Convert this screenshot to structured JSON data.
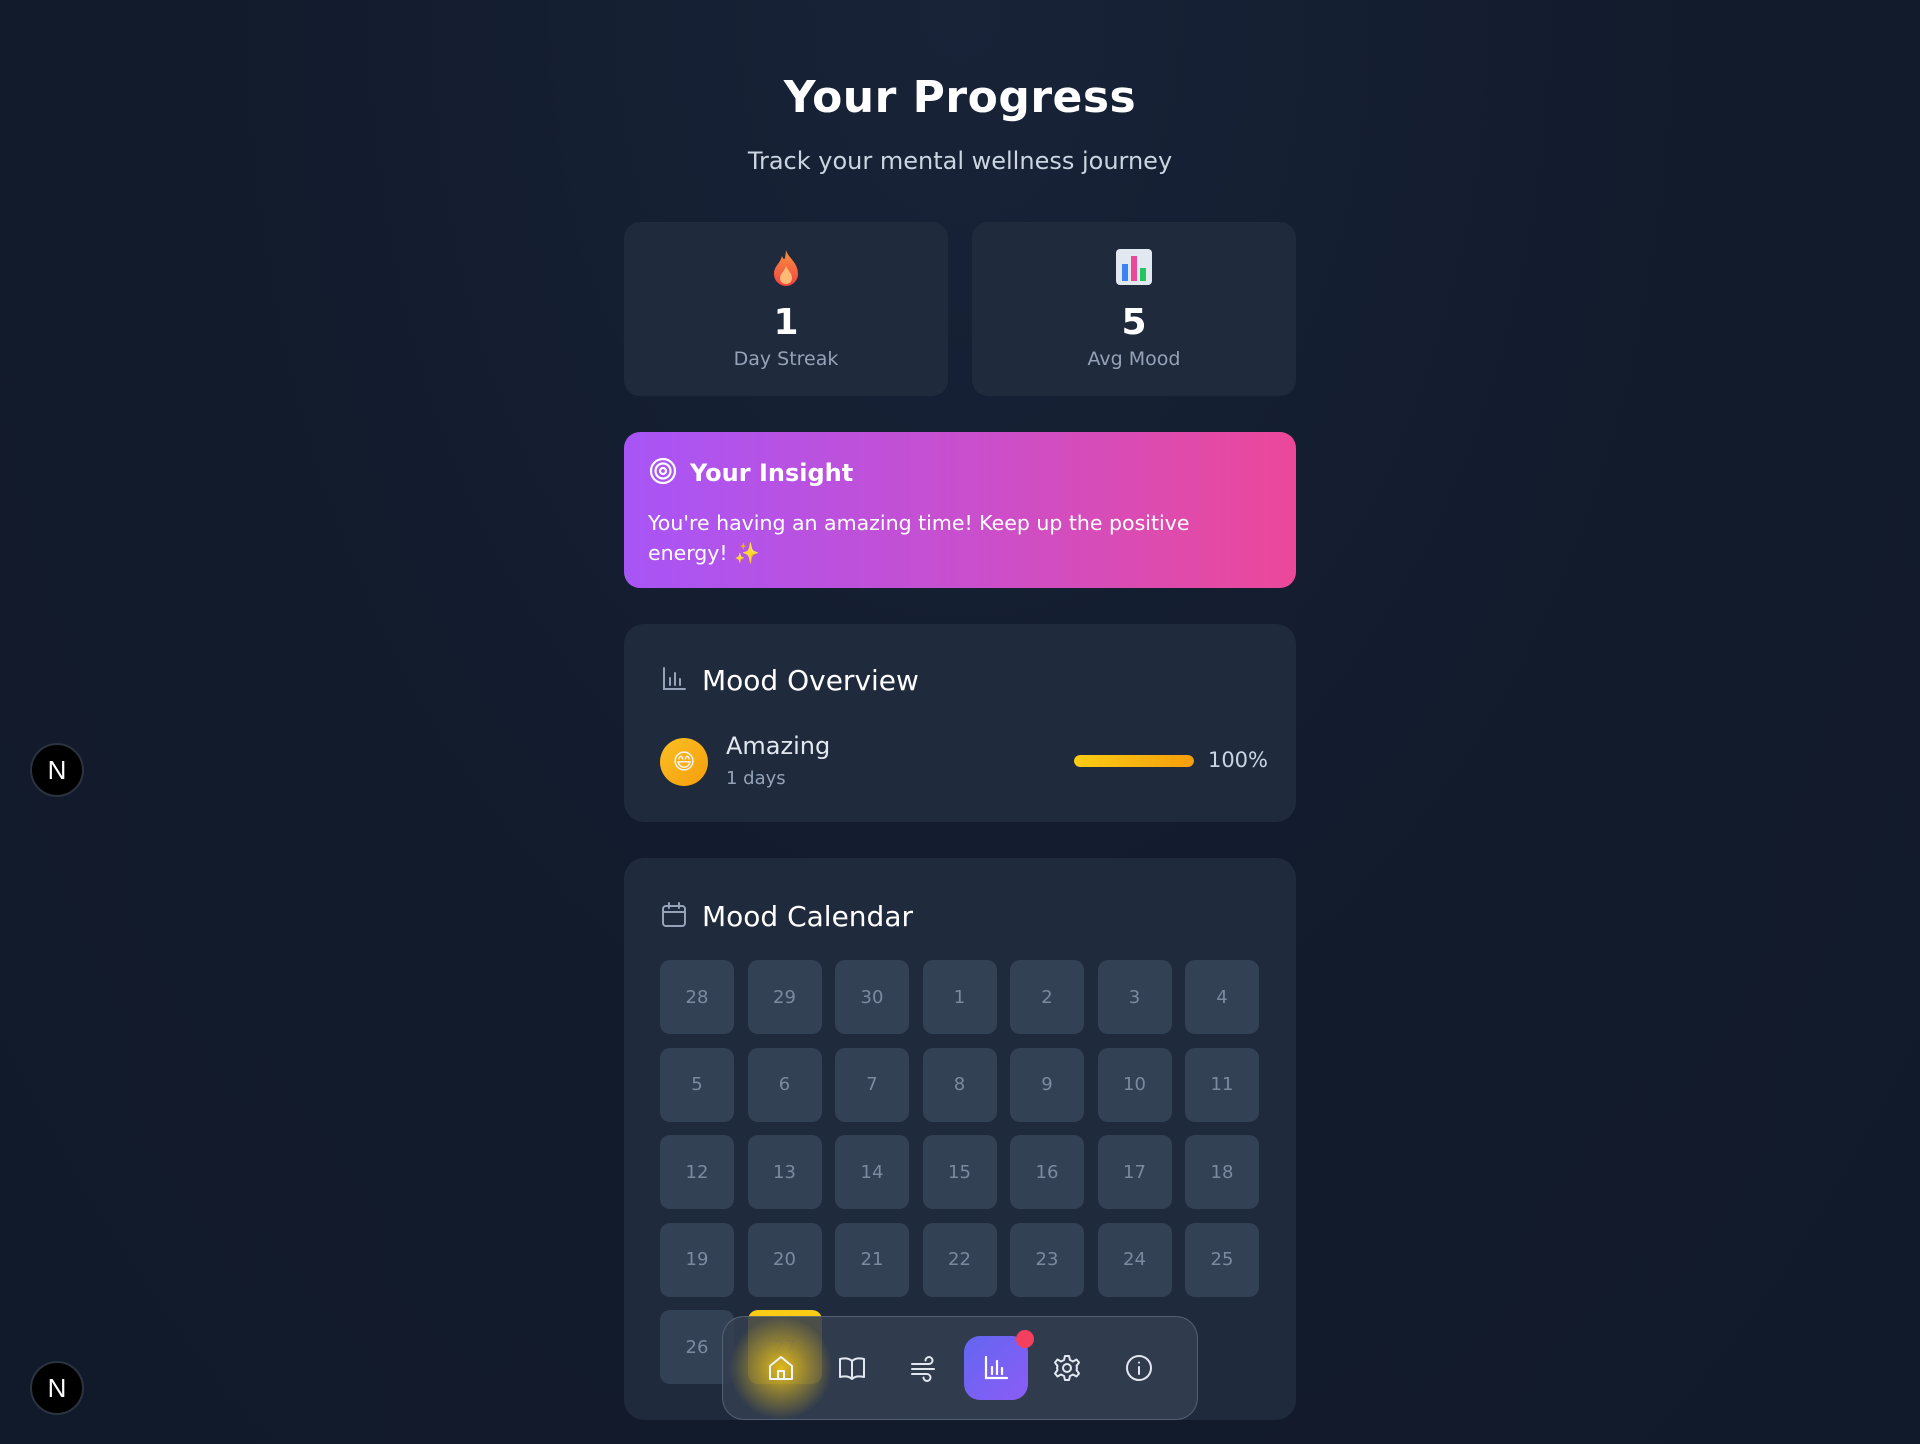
{
  "header": {
    "title": "Your Progress",
    "subtitle": "Track your mental wellness journey"
  },
  "stats": {
    "streak": {
      "icon": "flame-icon",
      "value": "1",
      "label": "Day Streak"
    },
    "avg_mood": {
      "icon": "bar-chart-icon",
      "value": "5",
      "label": "Avg Mood"
    }
  },
  "insight": {
    "icon": "target-icon",
    "title": "Your Insight",
    "text": "You're having an amazing time! Keep up the positive energy! ✨"
  },
  "mood_overview": {
    "icon": "bar-chart-icon",
    "title": "Mood Overview",
    "entries": [
      {
        "emoji": "😄",
        "name": "Amazing",
        "days": "1 days",
        "percent_label": "100%",
        "fraction": 1.0
      }
    ]
  },
  "mood_calendar": {
    "icon": "calendar-icon",
    "title": "Mood Calendar",
    "days": [
      "28",
      "29",
      "30",
      "1",
      "2",
      "3",
      "4",
      "5",
      "6",
      "7",
      "8",
      "9",
      "10",
      "11",
      "12",
      "13",
      "14",
      "15",
      "16",
      "17",
      "18",
      "19",
      "20",
      "21",
      "22",
      "23",
      "24",
      "25",
      "26",
      "27"
    ],
    "highlighted_day": "27",
    "highlight_color": "#facc15"
  },
  "bottom_nav": {
    "items": [
      "home-icon",
      "journal-icon",
      "breathe-icon",
      "stats-icon",
      "settings-icon",
      "info-icon"
    ],
    "active": "stats-icon",
    "notification_dot": true
  },
  "dev_badges": {
    "letter": "N"
  },
  "colors": {
    "background": "#121b2c",
    "card": "#1f2a3d",
    "insight_gradient_start": "#a855f7",
    "insight_gradient_end": "#ec4899",
    "accent": "#6366f1",
    "mood_amazing": "#facc15",
    "notification": "#f43f5e"
  }
}
